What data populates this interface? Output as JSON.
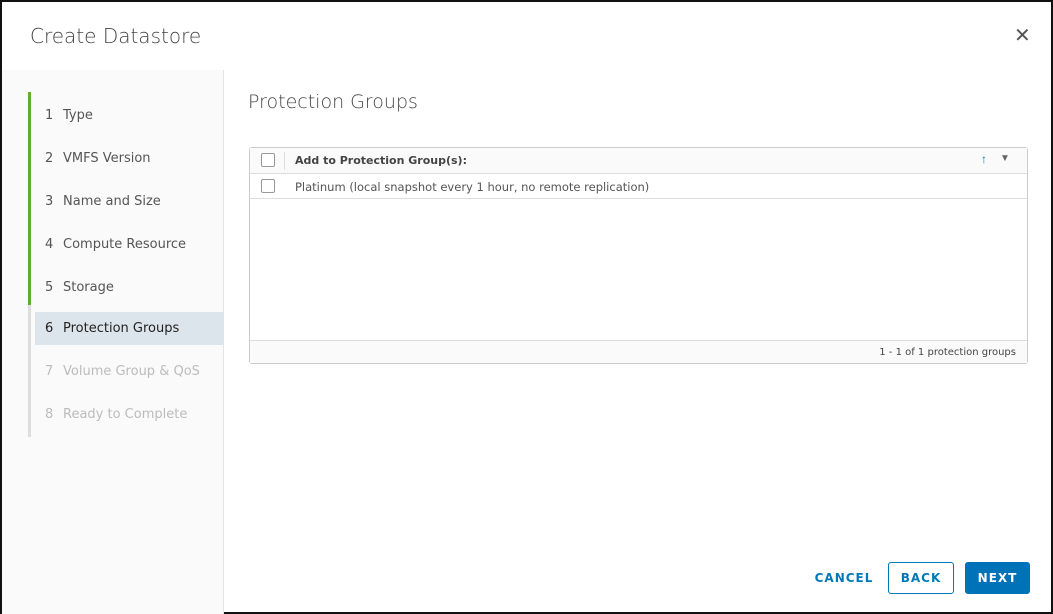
{
  "dialog": {
    "title": "Create Datastore",
    "close_icon": "close-icon"
  },
  "steps": [
    {
      "num": "1",
      "label": "Type",
      "state": "done"
    },
    {
      "num": "2",
      "label": "VMFS Version",
      "state": "done"
    },
    {
      "num": "3",
      "label": "Name and Size",
      "state": "done"
    },
    {
      "num": "4",
      "label": "Compute Resource",
      "state": "done"
    },
    {
      "num": "5",
      "label": "Storage",
      "state": "done"
    },
    {
      "num": "6",
      "label": "Protection Groups",
      "state": "current"
    },
    {
      "num": "7",
      "label": "Volume Group & QoS",
      "state": "disabled"
    },
    {
      "num": "8",
      "label": "Ready to Complete",
      "state": "disabled"
    }
  ],
  "page": {
    "title": "Protection Groups"
  },
  "grid": {
    "column_header": "Add to Protection Group(s):",
    "rows": [
      {
        "label": "Platinum (local snapshot every 1 hour, no remote replication)",
        "checked": false
      }
    ],
    "footer": "1 - 1 of 1 protection groups"
  },
  "buttons": {
    "cancel": "CANCEL",
    "back": "BACK",
    "next": "NEXT"
  },
  "colors": {
    "accent": "#0072b8",
    "progress": "#5aaf2e",
    "selected": "#dde5ec"
  }
}
